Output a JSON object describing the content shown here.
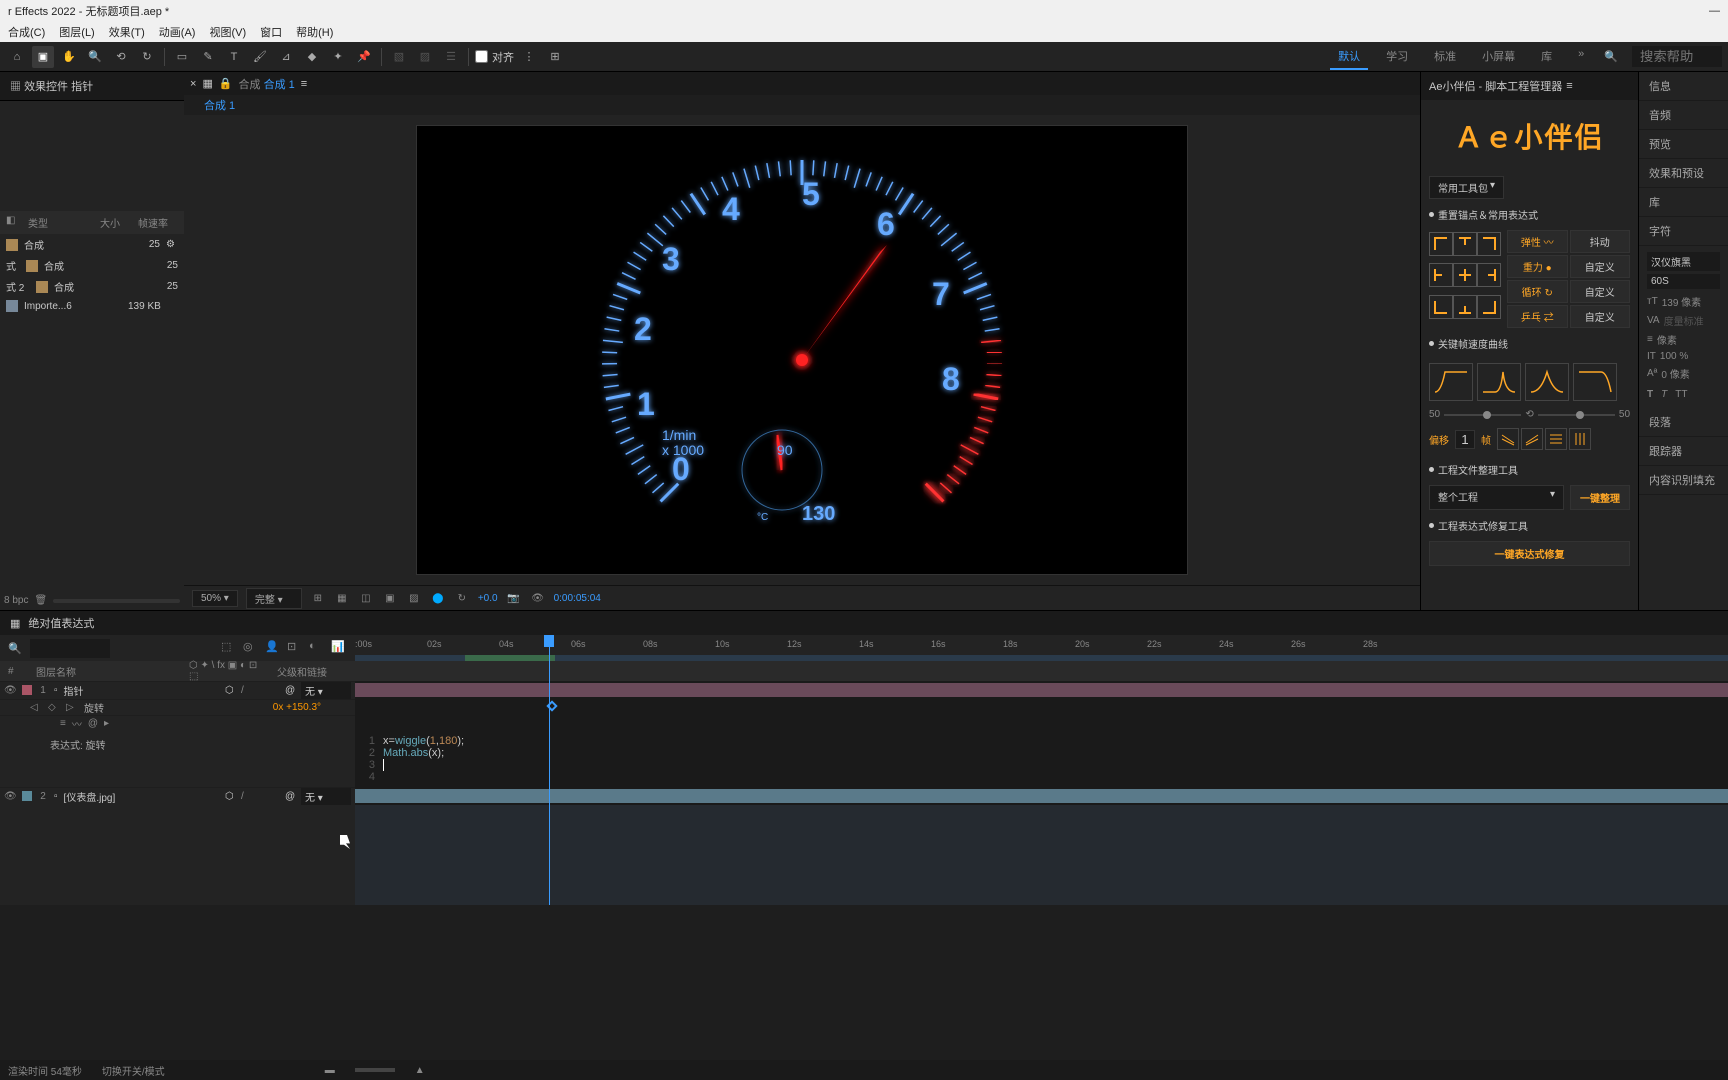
{
  "title_bar": {
    "title": "r Effects 2022 - 无标题项目.aep *"
  },
  "menu": {
    "composition": "合成(C)",
    "layer": "图层(L)",
    "effect": "效果(T)",
    "animation": "动画(A)",
    "view": "视图(V)",
    "window": "窗口",
    "help": "帮助(H)"
  },
  "toolbar": {
    "align_label": "对齐"
  },
  "workspaces": {
    "default": "默认",
    "learn": "学习",
    "standard": "标准",
    "small_screen": "小屏幕",
    "library": "库"
  },
  "search_placeholder": "搜索帮助",
  "effect_controls": {
    "tab": "效果控件 指针"
  },
  "project": {
    "col_type": "类型",
    "col_size": "大小",
    "col_fps": "帧速率",
    "items": [
      {
        "name": "",
        "type": "合成",
        "fps": "25"
      },
      {
        "name": "式",
        "type": "合成",
        "fps": "25"
      },
      {
        "name": "式 2",
        "type": "合成",
        "fps": "25"
      },
      {
        "name": "Importe...6",
        "type": "",
        "size": "139 KB"
      }
    ],
    "bpc": "8 bpc"
  },
  "composition": {
    "label": "合成",
    "name": "合成 1",
    "sub_tab": "合成 1"
  },
  "viewer": {
    "zoom": "50%",
    "quality": "完整",
    "exposure": "+0.0",
    "timecode": "0:00:05:04"
  },
  "script_panel": {
    "title": "Ae小伴侣 - 脚本工程管理器",
    "logo": "Ａｅ小伴侣",
    "toolkit_dropdown": "常用工具包",
    "anchor_section": "重置锚点＆常用表达式",
    "expr_buttons": {
      "elastic": "弹性",
      "shake": "抖动",
      "gravity": "重力",
      "custom1": "自定义",
      "loop": "循环",
      "custom2": "自定义",
      "pingpong": "乒乓",
      "custom3": "自定义"
    },
    "curve_section": "关键帧速度曲线",
    "slider_min": "50",
    "slider_max": "50",
    "offset_label": "偏移",
    "offset_value": "1",
    "frame_label": "帧",
    "project_tools": "工程文件整理工具",
    "project_dropdown": "整个工程",
    "organize_btn": "一键整理",
    "expr_fix_section": "工程表达式修复工具",
    "expr_fix_btn": "一键表达式修复"
  },
  "right_tabs": {
    "info": "信息",
    "audio": "音频",
    "preview": "预览",
    "effects_presets": "效果和预设",
    "library": "库",
    "character": "字符",
    "paragraph": "段落",
    "tracker": "跟踪器",
    "content_aware": "内容识别填充"
  },
  "char_panel": {
    "font": "汉仪旗黑",
    "weight": "60S",
    "size": "139 像素",
    "scale": "像素",
    "vert": "100 %",
    "baseline": "0 像素"
  },
  "timeline": {
    "tab": "绝对值表达式",
    "col_layer": "图层名称",
    "col_parent": "父级和链接",
    "none": "无",
    "layers": [
      {
        "num": "1",
        "name": "指针",
        "parent": "无"
      },
      {
        "num": "2",
        "name": "[仪表盘.jpg]",
        "parent": "无"
      }
    ],
    "prop_rotate": "旋转",
    "prop_rotate_val": "0x +150.3°",
    "expr_label": "表达式: 旋转",
    "ticks": [
      ":00s",
      "02s",
      "04s",
      "06s",
      "08s",
      "10s",
      "12s",
      "14s",
      "16s",
      "18s",
      "20s",
      "22s",
      "24s",
      "26s",
      "28s"
    ]
  },
  "expression": {
    "line1_a": "x=",
    "line1_fn": "wiggle",
    "line1_b": "(",
    "line1_n1": "1",
    "line1_c": ",",
    "line1_n2": "180",
    "line1_d": ");",
    "line2_fn": "Math.abs",
    "line2_a": "(x);"
  },
  "status": {
    "render": "渲染时间 54毫秒",
    "toggle": "切换开关/模式"
  }
}
